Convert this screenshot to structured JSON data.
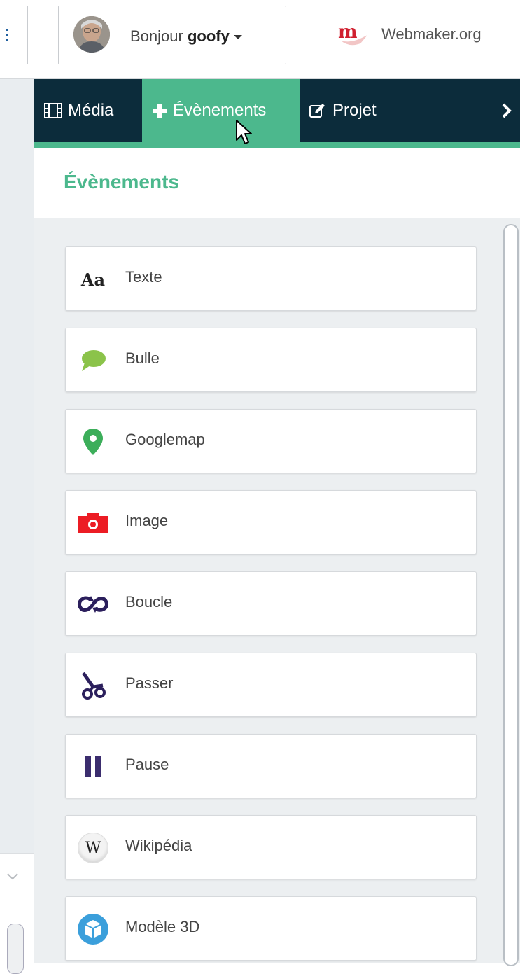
{
  "header": {
    "greeting": "Bonjour",
    "username": "goofy",
    "brand_text": "Webmaker.org"
  },
  "tabs": [
    {
      "label": "Média",
      "icon": "film-icon"
    },
    {
      "label": "Évènements",
      "icon": "plus-icon",
      "active": true
    },
    {
      "label": "Projet",
      "icon": "edit-icon"
    }
  ],
  "panel": {
    "title": "Évènements"
  },
  "events": [
    {
      "label": "Texte",
      "icon": "text-aa-icon",
      "icon_text": "Aa"
    },
    {
      "label": "Bulle",
      "icon": "speech-bubble-icon",
      "color": "#8bc34a"
    },
    {
      "label": "Googlemap",
      "icon": "map-pin-icon",
      "color": "#3cae5a"
    },
    {
      "label": "Image",
      "icon": "camera-icon",
      "color": "#ec1c24"
    },
    {
      "label": "Boucle",
      "icon": "loop-icon",
      "color": "#2b1f5c"
    },
    {
      "label": "Passer",
      "icon": "scissors-icon",
      "color": "#2b1f5c"
    },
    {
      "label": "Pause",
      "icon": "pause-icon",
      "color": "#3b2d6e"
    },
    {
      "label": "Wikipédia",
      "icon": "wikipedia-icon",
      "icon_text": "W"
    },
    {
      "label": "Modèle 3D",
      "icon": "cube-icon",
      "color": "#3b9fdb"
    }
  ],
  "colors": {
    "accent": "#4cb88d",
    "nav_bg": "#0c2c3b"
  }
}
